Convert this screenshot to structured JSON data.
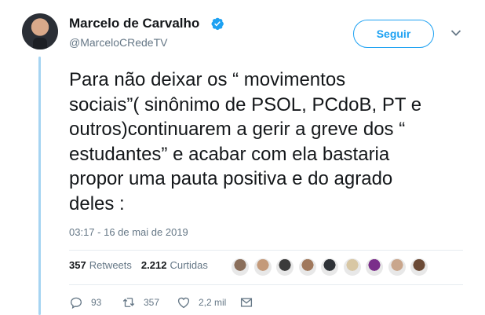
{
  "author": {
    "name": "Marcelo de Carvalho",
    "handle": "@MarceloCRedeTV",
    "verified": true
  },
  "follow_button": {
    "label": "Seguir"
  },
  "tweet": {
    "text_lines": [
      "Para não deixar os “ movimentos",
      "sociais”( sinônimo de PSOL, PCdoB, PT e",
      "outros)continuarem a gerir a greve dos “",
      "estudantes” e acabar com ela bastaria",
      "propor uma pauta positiva e do agrado",
      "deles :"
    ],
    "timestamp": "03:17 - 16 de mai de 2019"
  },
  "stats": {
    "retweets_count": "357",
    "retweets_label": "Retweets",
    "likes_count": "2.212",
    "likes_label": "Curtidas"
  },
  "likers": [
    {
      "icon": "liker-avatar-1",
      "color": "#8a6e5a"
    },
    {
      "icon": "liker-avatar-2",
      "color": "#c49a7a"
    },
    {
      "icon": "liker-avatar-3",
      "color": "#3b3b3b"
    },
    {
      "icon": "liker-avatar-4",
      "color": "#a0785c"
    },
    {
      "icon": "liker-avatar-5",
      "color": "#2f3338"
    },
    {
      "icon": "liker-avatar-6",
      "color": "#d8c7a4"
    },
    {
      "icon": "liker-avatar-7",
      "color": "#7a2f8a"
    },
    {
      "icon": "liker-avatar-8",
      "color": "#c9a68c"
    },
    {
      "icon": "liker-avatar-9",
      "color": "#6b4a36"
    }
  ],
  "actions": {
    "reply_count": "93",
    "retweet_count": "357",
    "like_count": "2,2 mil"
  },
  "colors": {
    "accent": "#1da1f2",
    "thread_line": "#a6d4f2",
    "secondary_text": "#657786"
  }
}
